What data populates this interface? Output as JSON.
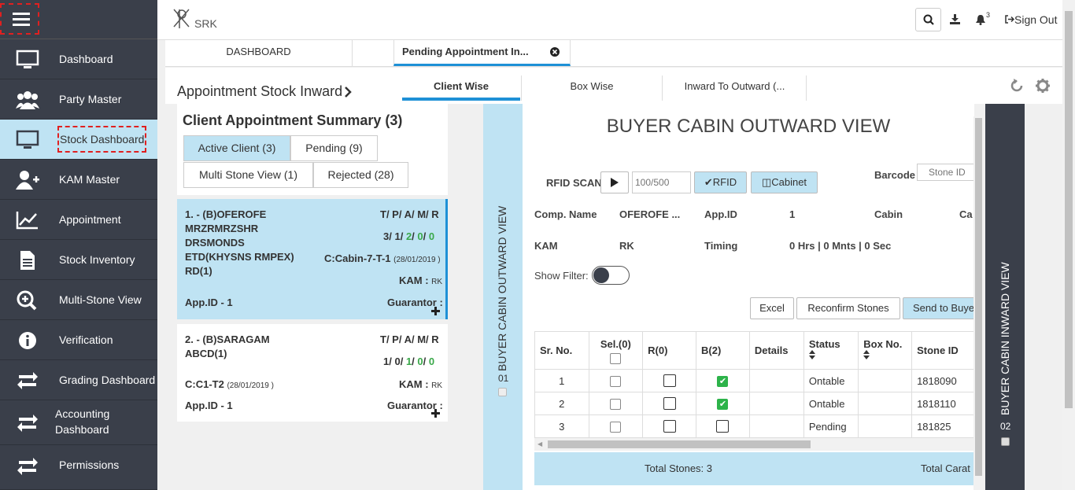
{
  "sidebar": {
    "items": [
      {
        "label": "Dashboard",
        "icon": "monitor-icon"
      },
      {
        "label": "Party Master",
        "icon": "users-icon"
      },
      {
        "label": "Stock Dashboard",
        "icon": "monitor-icon"
      },
      {
        "label": "KAM Master",
        "icon": "user-plus-icon"
      },
      {
        "label": "Appointment",
        "icon": "chart-line-icon"
      },
      {
        "label": "Stock Inventory",
        "icon": "document-icon"
      },
      {
        "label": "Multi-Stone View",
        "icon": "zoom-in-icon"
      },
      {
        "label": "Verification",
        "icon": "info-icon"
      },
      {
        "label": "Grading Dashboard",
        "icon": "exchange-icon"
      },
      {
        "label": "Accounting",
        "label2": "Dashboard",
        "icon": "exchange-icon"
      },
      {
        "label": "Permissions",
        "icon": "exchange-icon"
      }
    ]
  },
  "header": {
    "logo_text": "SRK",
    "notification_count": "3",
    "signout_label": "Sign Out"
  },
  "tabs": {
    "dashboard": "DASHBOARD",
    "pending": "Pending Appointment In..."
  },
  "subheader": {
    "title": "Appointment Stock Inward",
    "tabs": [
      "Client Wise",
      "Box Wise",
      "Inward To Outward (..."
    ]
  },
  "summary": {
    "title": "Client Appointment Summary (3)",
    "filters": [
      "Active Client (3)",
      "Pending (9)",
      "Multi Stone View (1)",
      "Rejected (28)"
    ]
  },
  "cards": [
    {
      "name_lines": [
        "1. - (B)OFEROFE",
        "MRZRMRZSHR",
        "DRSMONDS",
        "ETD(KHYSNS RMPEX)",
        "RD(1)"
      ],
      "tpamr_label": "T/ P/ A/ M/ R",
      "counts": [
        "3",
        "1",
        "2",
        "0",
        "0"
      ],
      "cabin": "C:Cabin-7-T-1",
      "date": "(28/01/2019 )",
      "kam_label": "KAM :",
      "kam": "RK",
      "appid": "App.ID - 1",
      "guarantor": "Guarantor :"
    },
    {
      "name_lines": [
        "2. - (B)SARAGAM",
        "ABCD(1)"
      ],
      "tpamr_label": "T/ P/ A/ M/ R",
      "counts": [
        "1",
        "0",
        "1",
        "0",
        "0"
      ],
      "cabin": "C:C1-T2",
      "date": "(28/01/2019 )",
      "kam_label": "KAM :",
      "kam": "RK",
      "appid": "App.ID - 1",
      "guarantor": "Guarantor :"
    }
  ],
  "strip_left": {
    "label": "BUYER CABIN OUTWARD VIEW",
    "num": "01"
  },
  "strip_right": {
    "label": "BUYER CABIN INWARD VIEW",
    "num": "02"
  },
  "main": {
    "title": "BUYER CABIN OUTWARD VIEW",
    "rfid_label": "RFID SCAN",
    "rfid_count": "100/500",
    "rfid_btn": "RFID",
    "cabinet_btn": "Cabinet",
    "barcode_label": "Barcode",
    "barcode_placeholder": "Stone ID",
    "comp_label": "Comp. Name",
    "comp_value": "OFEROFE ...",
    "appid_label": "App.ID",
    "appid_value": "1",
    "cabin_label": "Cabin",
    "cabin_extra": "Ca",
    "kam_label": "KAM",
    "kam_value": "RK",
    "timing_label": "Timing",
    "timing_value": "0 Hrs | 0 Mnts | 0 Sec",
    "show_filter": "Show Filter:",
    "buttons": [
      "Excel",
      "Reconfirm Stones",
      "Send to Buye"
    ],
    "table": {
      "headers": [
        "Sr. No.",
        "Sel.(0)",
        "R(0)",
        "B(2)",
        "Details",
        "Status",
        "Box No.",
        "Stone ID"
      ],
      "rows": [
        {
          "sr": "1",
          "b": true,
          "status": "Ontable",
          "stone": "1818090"
        },
        {
          "sr": "2",
          "b": true,
          "status": "Ontable",
          "stone": "1818110"
        },
        {
          "sr": "3",
          "b": false,
          "status": "Pending",
          "stone": "181825"
        }
      ]
    },
    "total_stones": "Total Stones: 3",
    "total_carat": "Total Carat"
  }
}
